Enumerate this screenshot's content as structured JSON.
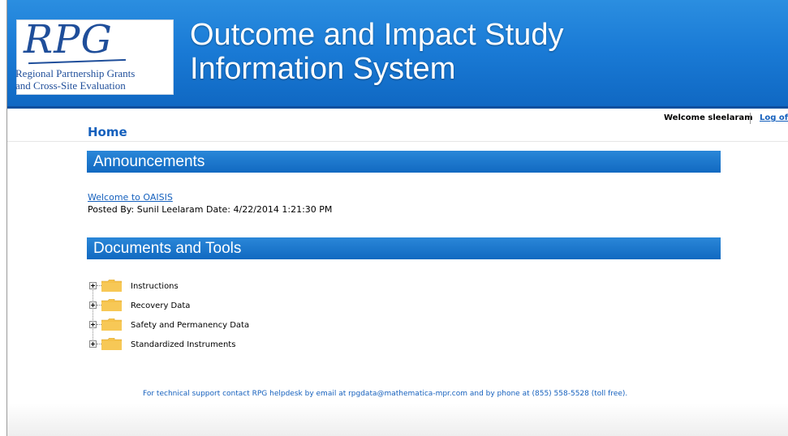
{
  "header": {
    "logo": {
      "mark": "RPG",
      "line1": "Regional Partnership Grants",
      "line2": "and Cross-Site Evaluation"
    },
    "title_line1": "Outcome and Impact Study",
    "title_line2": "Information System"
  },
  "user_bar": {
    "welcome": "Welcome sleelaram",
    "logoff": "Log of"
  },
  "page": {
    "title": "Home"
  },
  "announcements": {
    "heading": "Announcements",
    "items": [
      {
        "link": "Welcome to OAISIS",
        "meta": "Posted By: Sunil Leelaram Date: 4/22/2014 1:21:30 PM"
      }
    ]
  },
  "documents": {
    "heading": "Documents and Tools",
    "folders": [
      {
        "label": "Instructions",
        "icon": "folder-icon"
      },
      {
        "label": "Recovery Data",
        "icon": "folder-icon"
      },
      {
        "label": "Safety and Permanency Data",
        "icon": "folder-icon"
      },
      {
        "label": "Standardized Instruments",
        "icon": "folder-icon"
      }
    ]
  },
  "footer": {
    "support": "For technical support contact RPG helpdesk by email at rpgdata@mathematica-mpr.com and by phone at (855) 558-5528 (toll free)."
  },
  "colors": {
    "header_blue": "#1a7bd6",
    "section_blue": "#1169c1",
    "link_blue": "#1560bd",
    "folder_yellow": "#f5c24a"
  }
}
